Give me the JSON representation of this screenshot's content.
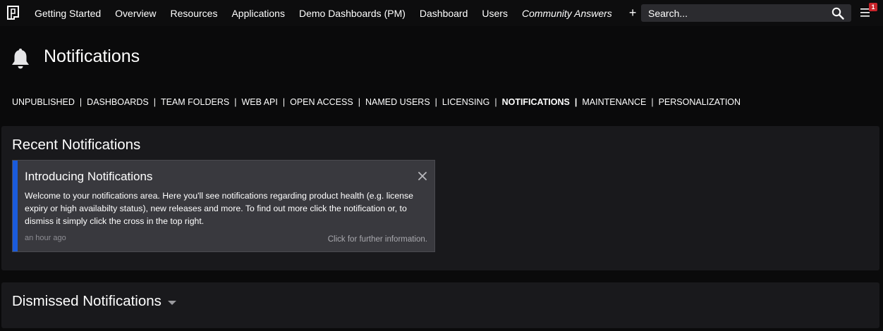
{
  "topbar": {
    "nav": [
      {
        "label": "Getting Started"
      },
      {
        "label": "Overview"
      },
      {
        "label": "Resources"
      },
      {
        "label": "Applications"
      },
      {
        "label": "Demo Dashboards (PM)"
      },
      {
        "label": "Dashboard"
      },
      {
        "label": "Users"
      },
      {
        "label": "Community Answers"
      }
    ],
    "plus_label": "+",
    "search_placeholder": "Search...",
    "menu_badge": "1",
    "logo_icon": "product-logo-icon",
    "search_icon": "search-icon",
    "menu_icon": "hamburger-menu-icon"
  },
  "page": {
    "title": "Notifications",
    "icon": "bell-icon"
  },
  "subnav": {
    "items": [
      {
        "label": "UNPUBLISHED"
      },
      {
        "label": "DASHBOARDS"
      },
      {
        "label": "TEAM FOLDERS"
      },
      {
        "label": "WEB API"
      },
      {
        "label": "OPEN ACCESS"
      },
      {
        "label": "NAMED USERS"
      },
      {
        "label": "LICENSING"
      },
      {
        "label": "NOTIFICATIONS"
      },
      {
        "label": "MAINTENANCE"
      },
      {
        "label": "PERSONALIZATION"
      }
    ],
    "separator": "|",
    "active": "NOTIFICATIONS"
  },
  "recent": {
    "title": "Recent Notifications",
    "notification": {
      "title": "Introducing Notifications",
      "body": "Welcome to your notifications area. Here you'll see notifications regarding product health (e.g. license expiry or high availabilty status), new releases and more. To find out more click the notification or, to dismiss it simply click the cross in the top right.",
      "time": "an hour ago",
      "more": "Click for further information.",
      "accent_color": "#1a5bdc"
    }
  },
  "dismissed": {
    "title": "Dismissed Notifications"
  },
  "colors": {
    "background": "#0a0a0b",
    "panel": "#19191c",
    "card": "#39393e",
    "badge": "#c8242b"
  }
}
